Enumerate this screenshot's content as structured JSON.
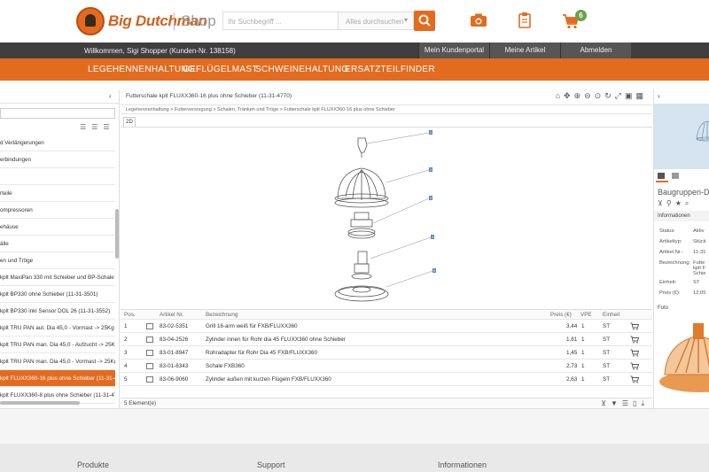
{
  "header": {
    "brand": "Big Dutchman",
    "shop": "Shop",
    "search_placeholder": "Ihr Suchbegriff ...",
    "scope_label": "Alles durchsuchen",
    "cart_count": "6",
    "icons": [
      "search-icon",
      "camera-icon",
      "clipboard-icon",
      "cart-icon"
    ],
    "accent": "#e36b1f"
  },
  "userbar": {
    "welcome": "Willkommen, Sigi Shopper (Kunden-Nr. 138158)",
    "buttons": [
      "Mein Kundenportal",
      "Meine Artikel",
      "Abmelden"
    ]
  },
  "nav": [
    "LEGEHENNENHALTUNG",
    "GEFLÜGELMAST",
    "SCHWEINEHALTUNG",
    "ERSATZTEILFINDER"
  ],
  "tree": {
    "items": [
      "d Verlängerungen",
      "erbindungen",
      "",
      "rteile",
      "ompressoren",
      "ehäuse",
      "älle",
      "en und Tröge",
      "kplt MaxiPan 330 mit Schieber und BP-Schale (",
      "kplt BP330 ohne Schieber (11-31-3501)",
      "kplt BP330 inkl Sensor DOL 26 (11-31-3552)",
      "kplt TRU PAN aut. Dia 45,0 - Vormast -> 25Kg (",
      "kplt TRU PAN man. Dia 45,0 - Aufzucht -> 25Kg",
      "kplt TRU PAN man. Dia 45,0 - Vormast -> 25Kg",
      "kplt FLUXX360-16 plus ohne Schieber (11-31-4",
      "kplt FLUXX360-8 plus ohne Schieber (11-31-47"
    ],
    "selected_index": 14
  },
  "main": {
    "title": "Futterschale kplt FLUXX360-16 plus ohne Schieber (11-31-4770)",
    "breadcrumb": "Legehennenhaltung > Futterversorgung > Schalen, Tränken und Tröge > Futterschale kplt FLUXX360-16 plus ohne Schieber",
    "tab": "2D",
    "columns": [
      "Pos.",
      "Artikel Nr.",
      "Bezeichnung",
      "Preis (€)",
      "VPE",
      "Einheit"
    ],
    "rows": [
      {
        "pos": "1",
        "nr": "83-02-5351",
        "name": "Grill 16-arm weiß für FXB/FLUXX360",
        "price": "3,44",
        "vpe": "1",
        "unit": "ST"
      },
      {
        "pos": "2",
        "nr": "83-04-2526",
        "name": "Zylinder innen für Rohr dia 45 FLUXX360 ohne Schieber",
        "price": "1,81",
        "vpe": "1",
        "unit": "ST"
      },
      {
        "pos": "3",
        "nr": "83-01-8947",
        "name": "Rohradapter für Rohr Dia 45 FXB/FLUXX360",
        "price": "1,45",
        "vpe": "1",
        "unit": "ST"
      },
      {
        "pos": "4",
        "nr": "83-01-6343",
        "name": "Schale FXB360",
        "price": "2,73",
        "vpe": "1",
        "unit": "ST"
      },
      {
        "pos": "5",
        "nr": "83-06-9060",
        "name": "Zylinder außen mit kurzen Flügeln FXB/FLUXX360",
        "price": "2,63",
        "vpe": "1",
        "unit": "ST"
      }
    ],
    "footer": "5 Element(e)",
    "callouts": [
      "1",
      "2",
      "3",
      "4",
      "5"
    ]
  },
  "right": {
    "title": "Baugruppen-D",
    "info_section": "Informationen",
    "props": [
      {
        "k": "Status:",
        "v": "Aktiv"
      },
      {
        "k": "Artikeltyp:",
        "v": "Stück"
      },
      {
        "k": "Artikel Nr.:",
        "v": "11-31"
      },
      {
        "k": "Bezeichnung:",
        "v": "Futte"
      },
      {
        "k": "",
        "v": "kplt F"
      },
      {
        "k": "",
        "v": "Schie"
      },
      {
        "k": "Einheit:",
        "v": "ST"
      },
      {
        "k": "Preis (€):",
        "v": "12,05"
      }
    ],
    "photo_section": "Foto"
  },
  "footer": [
    "Produkte",
    "Support",
    "Informationen"
  ]
}
